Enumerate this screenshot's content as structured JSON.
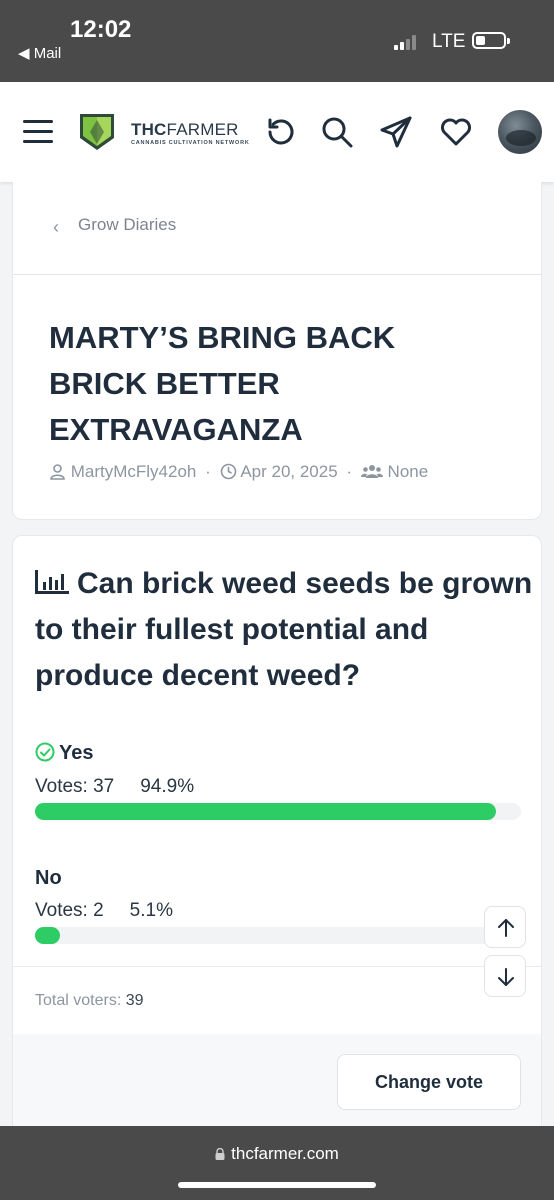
{
  "status_bar": {
    "time": "12:02",
    "back_label": "◀ Mail",
    "network": "LTE"
  },
  "header": {
    "logo_text_bold": "THC",
    "logo_text_regular": "FARMER",
    "logo_subtitle": "CANNABIS CULTIVATION NETWORK",
    "icons": [
      "menu-icon",
      "history-icon",
      "search-icon",
      "send-icon",
      "heart-icon",
      "avatar"
    ]
  },
  "breadcrumb": {
    "chevron": "‹",
    "label": "Grow Diaries"
  },
  "thread": {
    "title": "MARTY’S BRING BACK BRICK BETTER EXTRAVAGANZA",
    "author": "MartyMcFly42oh",
    "date": "Apr 20, 2025",
    "audience": "None",
    "separator": "·"
  },
  "poll": {
    "question": "Can brick weed seeds be grown to their fullest potential and produce decent weed?",
    "options": [
      {
        "label": "Yes",
        "votes_text": "Votes: 37",
        "percent_text": "94.9%",
        "fraction": 0.949,
        "selected": true
      },
      {
        "label": "No",
        "votes_text": "Votes: 2",
        "percent_text": "5.1%",
        "fraction": 0.051,
        "selected": false
      }
    ],
    "total_label": "Total voters:",
    "total_value": "39",
    "change_vote_label": "Change vote"
  },
  "browser": {
    "url": "thcfarmer.com"
  },
  "colors": {
    "accent_green": "#2ecc65",
    "text_dark": "#1f2d3d",
    "status_bar": "#4a4a4a"
  }
}
